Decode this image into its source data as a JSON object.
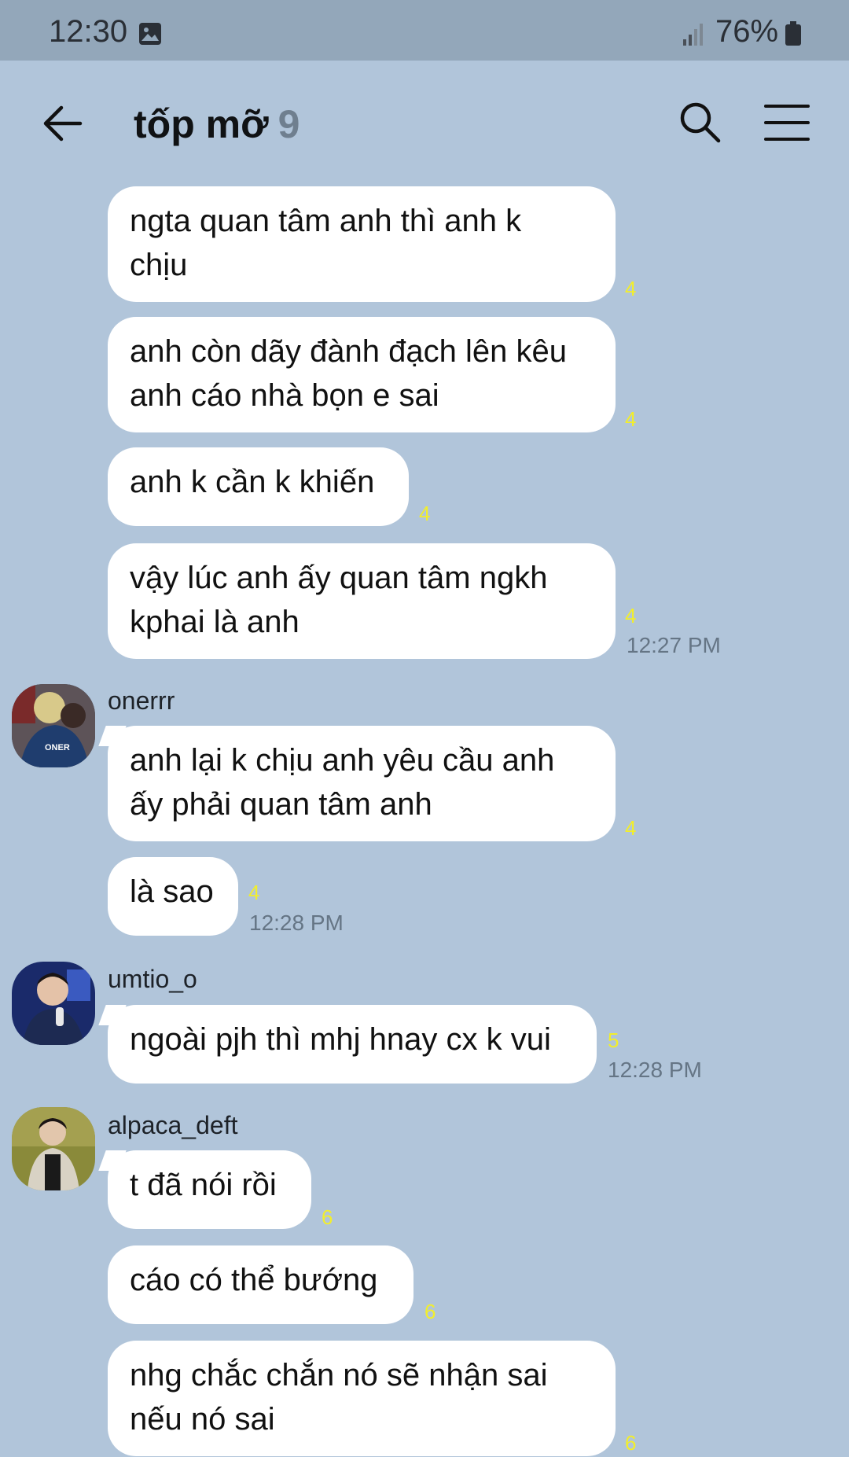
{
  "status_bar": {
    "time": "12:30",
    "battery": "76%",
    "icons": [
      "gallery-icon",
      "signal-icon",
      "battery-icon"
    ]
  },
  "header": {
    "title": "tốp mỡ",
    "member_count": "9",
    "icons": [
      "back-arrow-icon",
      "search-icon",
      "menu-icon"
    ]
  },
  "messages": [
    {
      "text": "ngta quan tâm anh thì anh k\nchịu",
      "unread": "4"
    },
    {
      "text": "anh còn dãy đành đạch lên kêu\nanh cáo nhà bọn e sai",
      "unread": "4"
    },
    {
      "text": "anh k cần k khiến",
      "unread": "4"
    },
    {
      "text": "vậy lúc anh ấy quan tâm ngkh\nkphai là anh",
      "unread": "4",
      "time": "12:27 PM"
    },
    {
      "sender": "onerrr",
      "text": "anh lại k chịu anh yêu cầu anh\nấy phải quan tâm anh",
      "unread": "4"
    },
    {
      "text": "là sao",
      "unread": "4",
      "time": "12:28 PM"
    },
    {
      "sender": "umtio_o",
      "text": "ngoài pjh thì mhj hnay cx k vui",
      "unread": "5",
      "time": "12:28 PM"
    },
    {
      "sender": "alpaca_deft",
      "text": "t đã nói rồi",
      "unread": "6"
    },
    {
      "text": "cáo có thể bướng",
      "unread": "6"
    },
    {
      "text": "nhg chắc chắn nó sẽ nhận sai\nnếu nó sai",
      "unread": "6"
    }
  ],
  "colors": {
    "background": "#b1c5da",
    "status_bar": "#93a7ba",
    "bubble": "#ffffff",
    "unread": "#f2ee2c",
    "timestamp": "#657585"
  }
}
